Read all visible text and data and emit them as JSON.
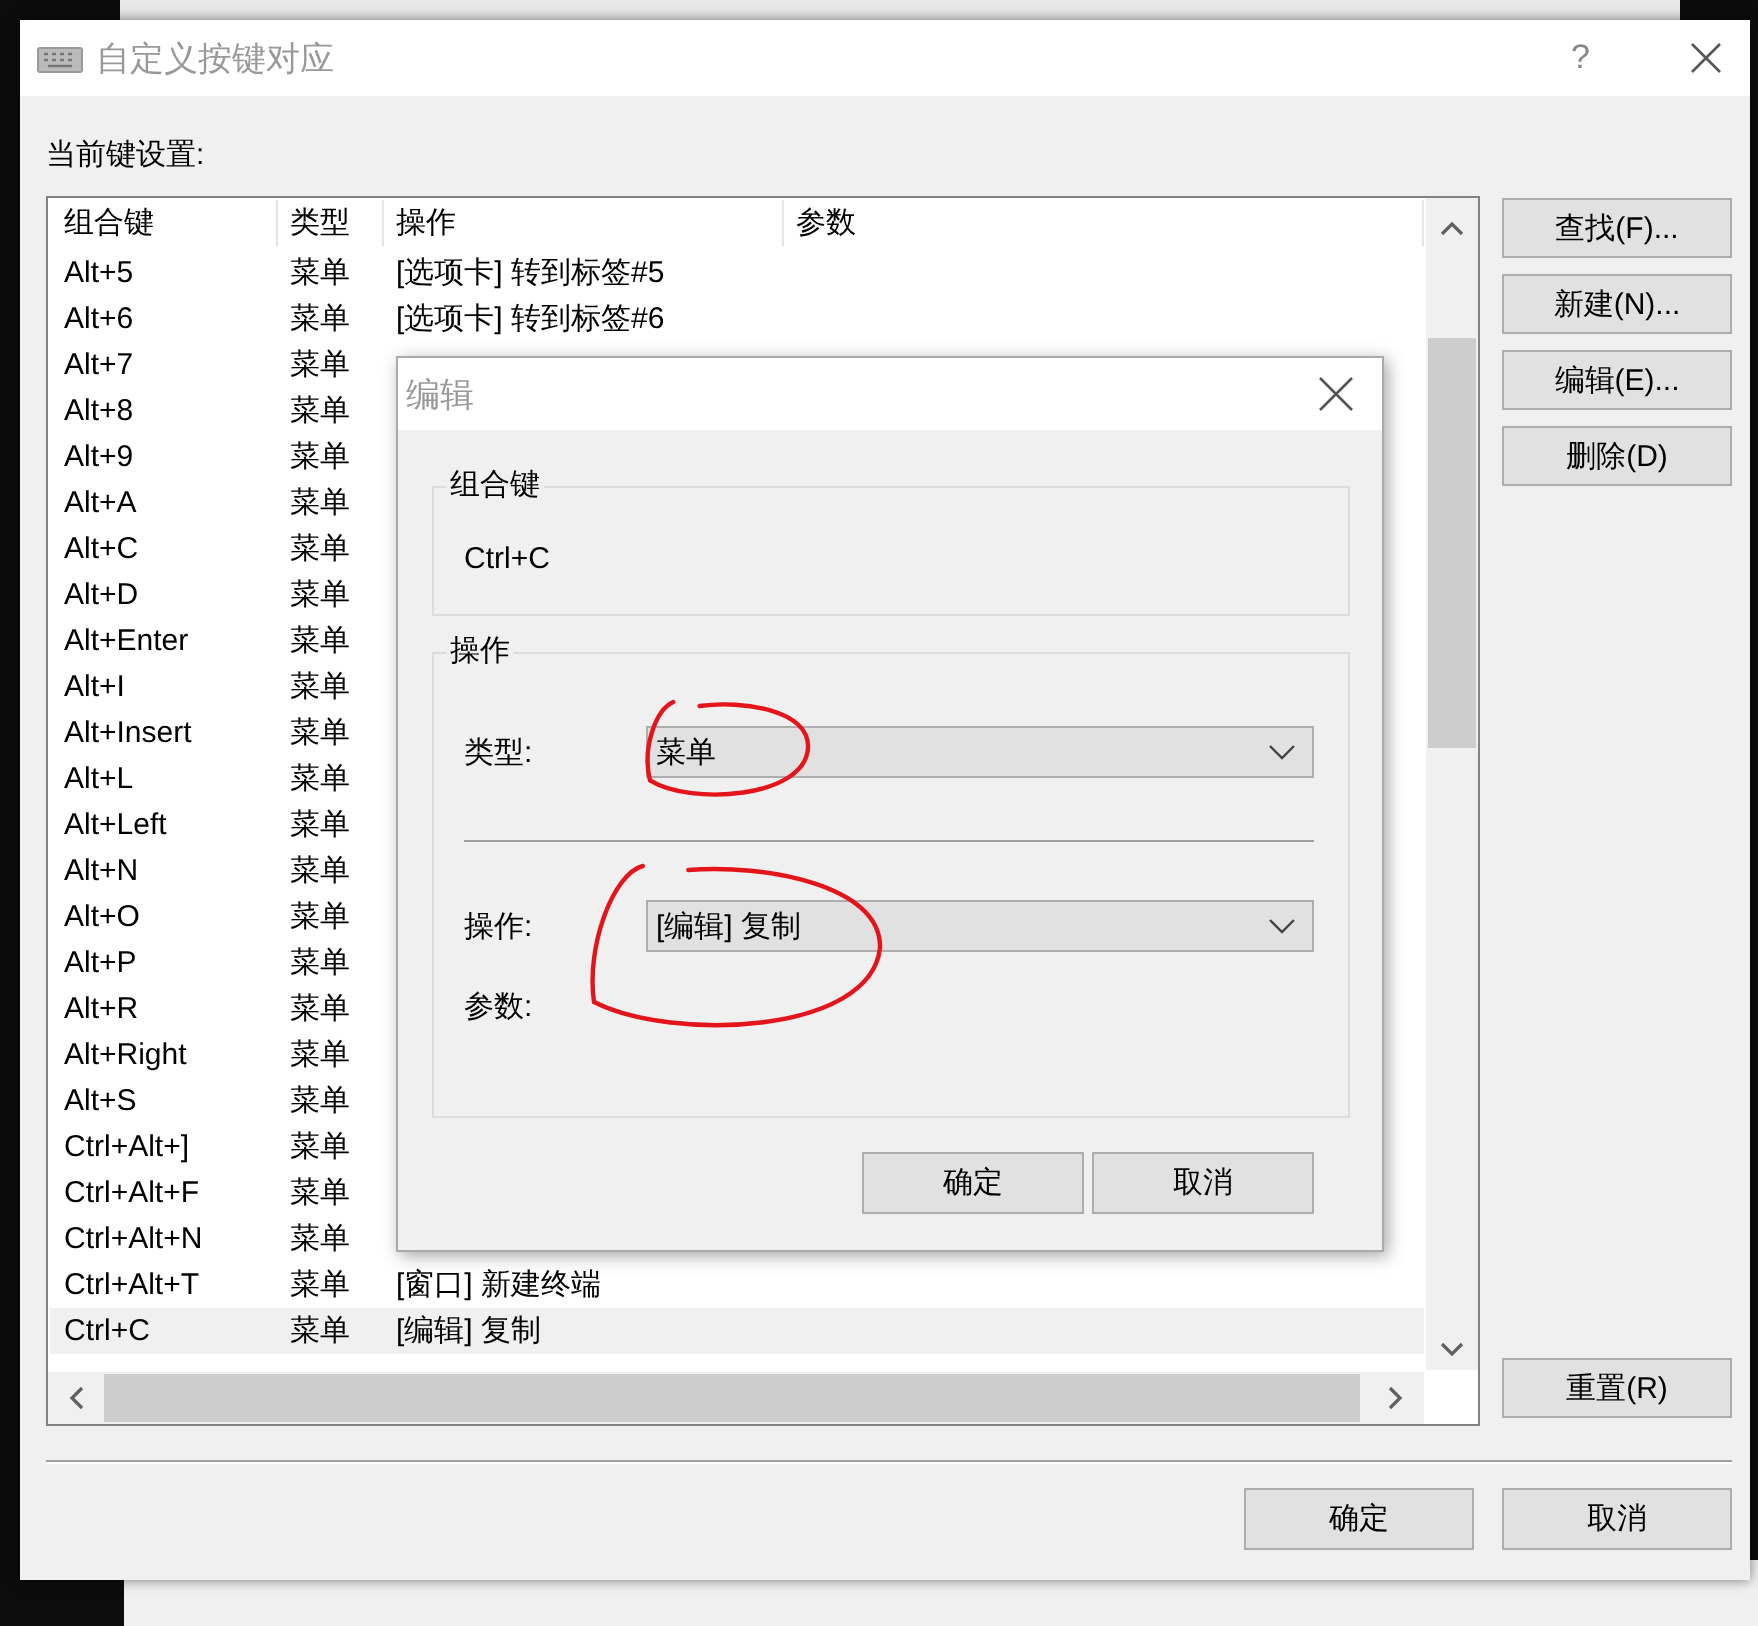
{
  "window": {
    "title": "自定义按键对应",
    "help": "?",
    "label": "当前键设置:"
  },
  "table": {
    "columns": [
      "组合键",
      "类型",
      "操作",
      "参数"
    ],
    "rows": [
      {
        "key": "Alt+5",
        "type": "菜单",
        "operation": "[选项卡] 转到标签#5",
        "selected": false
      },
      {
        "key": "Alt+6",
        "type": "菜单",
        "operation": "[选项卡] 转到标签#6",
        "selected": false
      },
      {
        "key": "Alt+7",
        "type": "菜单",
        "selected": false
      },
      {
        "key": "Alt+8",
        "type": "菜单",
        "selected": false
      },
      {
        "key": "Alt+9",
        "type": "菜单",
        "selected": false
      },
      {
        "key": "Alt+A",
        "type": "菜单",
        "selected": false
      },
      {
        "key": "Alt+C",
        "type": "菜单",
        "selected": false
      },
      {
        "key": "Alt+D",
        "type": "菜单",
        "selected": false
      },
      {
        "key": "Alt+Enter",
        "type": "菜单",
        "selected": false
      },
      {
        "key": "Alt+I",
        "type": "菜单",
        "selected": false
      },
      {
        "key": "Alt+Insert",
        "type": "菜单",
        "selected": false
      },
      {
        "key": "Alt+L",
        "type": "菜单",
        "selected": false
      },
      {
        "key": "Alt+Left",
        "type": "菜单",
        "selected": false
      },
      {
        "key": "Alt+N",
        "type": "菜单",
        "selected": false
      },
      {
        "key": "Alt+O",
        "type": "菜单",
        "selected": false
      },
      {
        "key": "Alt+P",
        "type": "菜单",
        "selected": false
      },
      {
        "key": "Alt+R",
        "type": "菜单",
        "selected": false
      },
      {
        "key": "Alt+Right",
        "type": "菜单",
        "selected": false
      },
      {
        "key": "Alt+S",
        "type": "菜单",
        "selected": false
      },
      {
        "key": "Ctrl+Alt+]",
        "type": "菜单",
        "selected": false
      },
      {
        "key": "Ctrl+Alt+F",
        "type": "菜单",
        "selected": false
      },
      {
        "key": "Ctrl+Alt+N",
        "type": "菜单",
        "selected": false
      },
      {
        "key": "Ctrl+Alt+T",
        "type": "菜单",
        "operation": "[窗口] 新建终端",
        "selected": false
      },
      {
        "key": "Ctrl+C",
        "type": "菜单",
        "operation": "[编辑] 复制",
        "selected": true
      }
    ]
  },
  "side_buttons": [
    "查找(F)...",
    "新建(N)...",
    "编辑(E)...",
    "删除(D)"
  ],
  "reset_button": "重置(R)",
  "buttons": [
    "确定",
    "取消"
  ],
  "edit_dialog": {
    "title": "编辑",
    "key_group": {
      "label": "组合键",
      "value": "Ctrl+C"
    },
    "action_group": {
      "label": "操作",
      "fields": [
        {
          "kind": "dropdown",
          "label": "类型:",
          "value": "菜单",
          "circled": true
        },
        {
          "kind": "separator"
        },
        {
          "kind": "dropdown",
          "label": "操作:",
          "value": "[编辑] 复制",
          "circled": true
        },
        {
          "kind": "label",
          "label": "参数:"
        }
      ]
    },
    "buttons": [
      "确定",
      "取消"
    ]
  }
}
